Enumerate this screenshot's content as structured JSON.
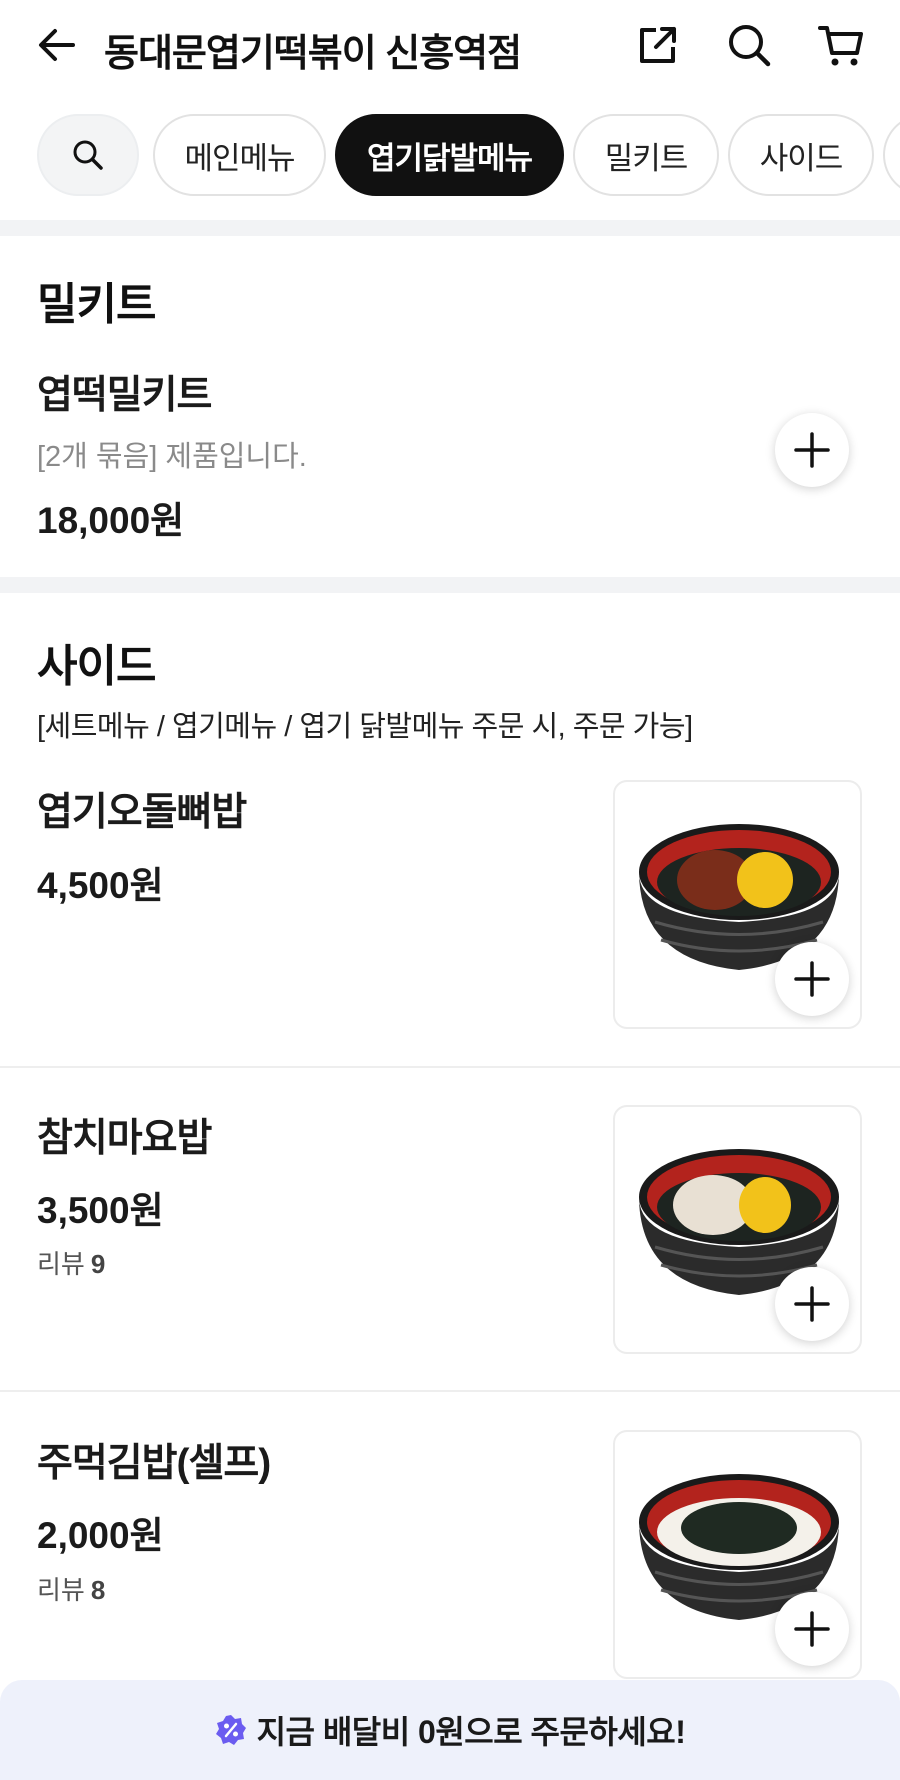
{
  "header": {
    "store_name": "동대문엽기떡볶이 신흥역점",
    "icons": [
      "back-arrow-icon",
      "share-icon",
      "search-icon",
      "cart-icon"
    ]
  },
  "categories": {
    "items": [
      "메인메뉴",
      "엽기닭발메뉴",
      "밀키트",
      "사이드"
    ],
    "active": "엽기닭발메뉴"
  },
  "mealkit_section": {
    "title": "밀키트",
    "items": [
      {
        "name": "엽떡밀키트",
        "description": "[2개 묶음] 제품입니다.",
        "price": "18,000원"
      }
    ]
  },
  "side_section": {
    "title": "사이드",
    "description": "[세트메뉴 / 엽기메뉴 / 엽기 닭발메뉴 주문 시, 주문 가능]",
    "items": [
      {
        "name": "엽기오돌뼈밥",
        "price": "4,500원",
        "image": "rice-bowl-photo"
      },
      {
        "name": "참치마요밥",
        "price": "3,500원",
        "review_label": "리뷰",
        "review_count": "9",
        "image": "rice-bowl-photo"
      },
      {
        "name": "주먹김밥(셀프)",
        "price": "2,000원",
        "review_label": "리뷰",
        "review_count": "8",
        "image": "rice-bowl-photo"
      }
    ]
  },
  "promo": {
    "text": "지금 배달비 0원으로 주문하세요!",
    "icon": "discount-badge-icon",
    "color": "#6b5cf0"
  }
}
